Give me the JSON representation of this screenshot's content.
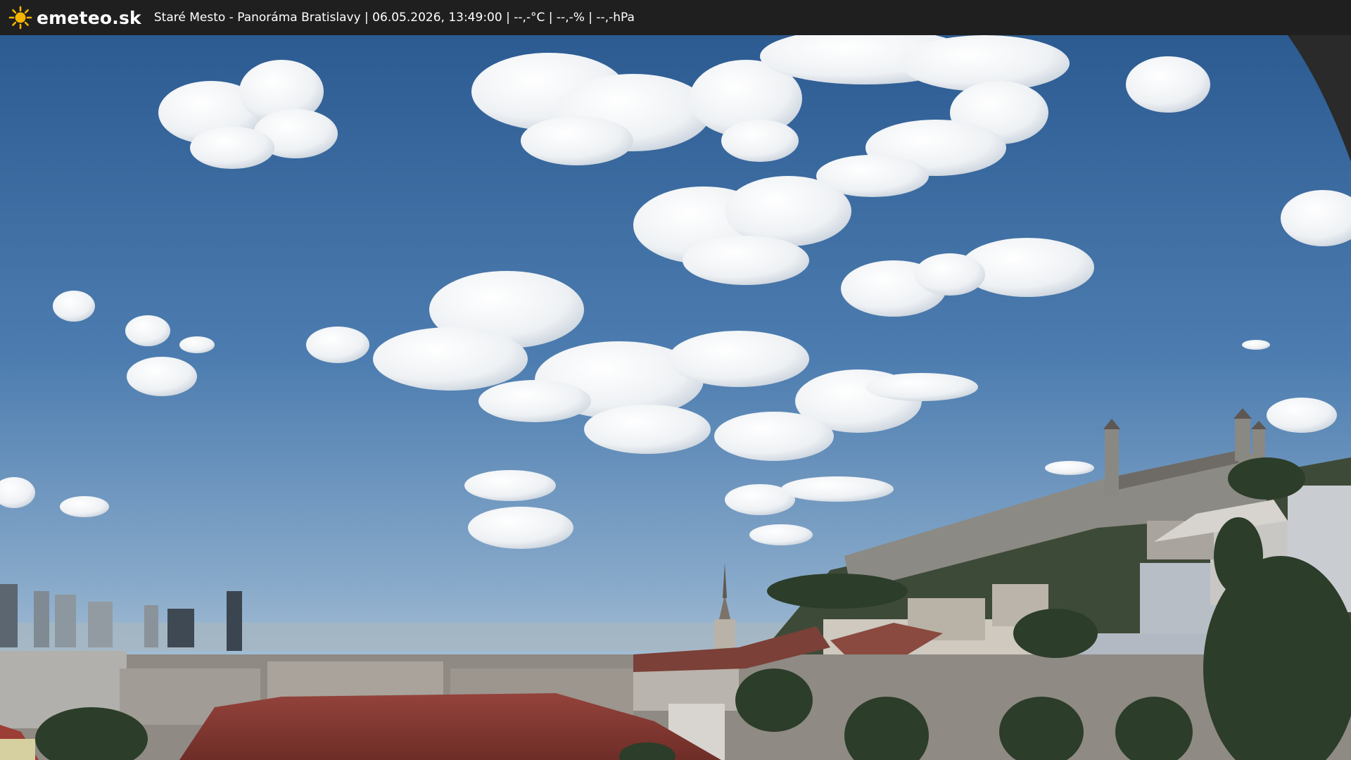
{
  "header": {
    "logo_text": "emeteo.sk",
    "logo_icon": "sun-icon",
    "info": "Staré Mesto - Panoráma Bratislavy | 06.05.2026, 13:49:00 | --,-°C | --,-% | --,-hPa"
  },
  "colors": {
    "bar_background": "#1f1f1f",
    "sun": "#f5b400",
    "sky_top": "#2f5e95",
    "sky_bottom": "#b9cde0",
    "roof": "#8a3a33",
    "trees": "#2c3d2a"
  },
  "webcam": {
    "subject": "panorama",
    "visible_elements": [
      "sky-with-clouds",
      "castle",
      "church-spire",
      "high-rise-buildings",
      "rooftops",
      "trees"
    ]
  }
}
